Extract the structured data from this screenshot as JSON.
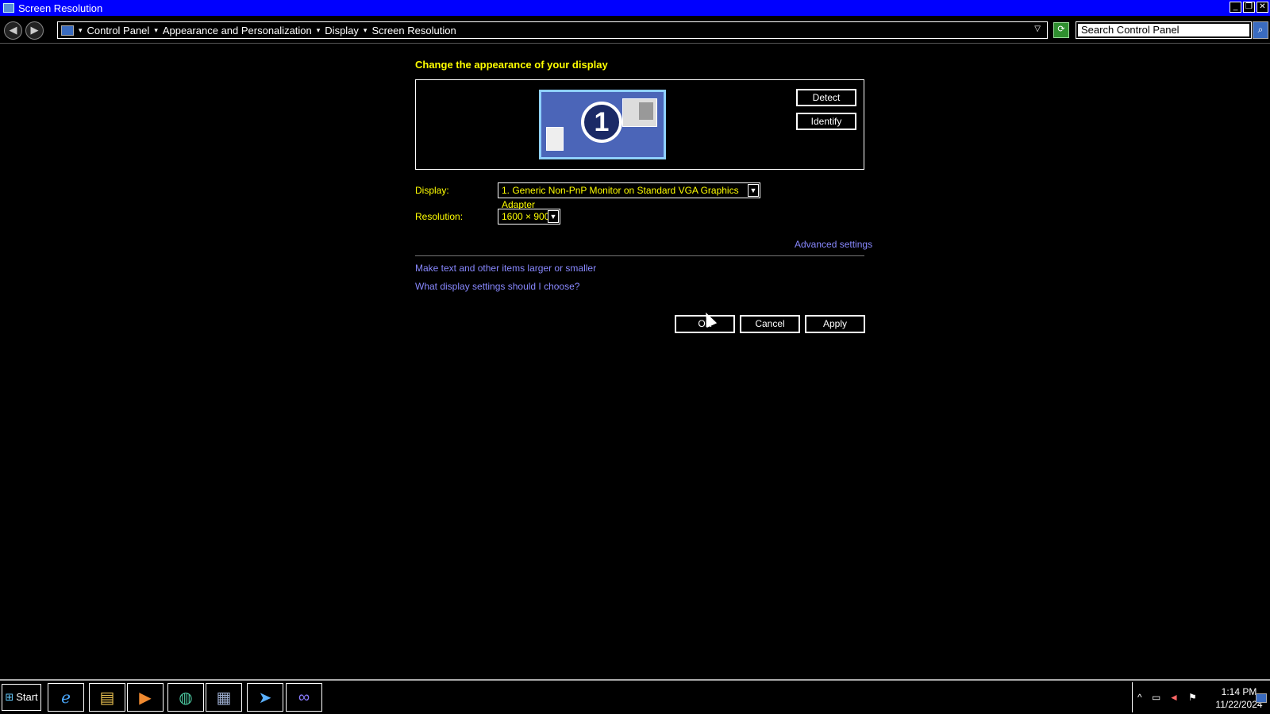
{
  "window": {
    "title": "Screen Resolution"
  },
  "address": {
    "crumbs": [
      "Control Panel",
      "Appearance and Personalization",
      "Display",
      "Screen Resolution"
    ],
    "search_placeholder": "Search Control Panel"
  },
  "main": {
    "heading": "Change the appearance of your display",
    "monitor_number": "1",
    "detect_label": "Detect",
    "identify_label": "Identify",
    "display_label": "Display:",
    "display_value": "1. Generic Non-PnP Monitor on Standard VGA Graphics Adapter",
    "resolution_label": "Resolution:",
    "resolution_value": "1600 × 900",
    "advanced_link": "Advanced settings",
    "larger_link": "Make text and other items larger or smaller",
    "choose_link": "What display settings should I choose?",
    "ok_label": "OK",
    "cancel_label": "Cancel",
    "apply_label": "Apply"
  },
  "taskbar": {
    "start_label": "Start",
    "time": "1:14 PM",
    "date": "11/22/2024"
  },
  "colors": {
    "titlebar": "#0000ff",
    "label_yellow": "#ffff00",
    "link": "#8888ff"
  }
}
